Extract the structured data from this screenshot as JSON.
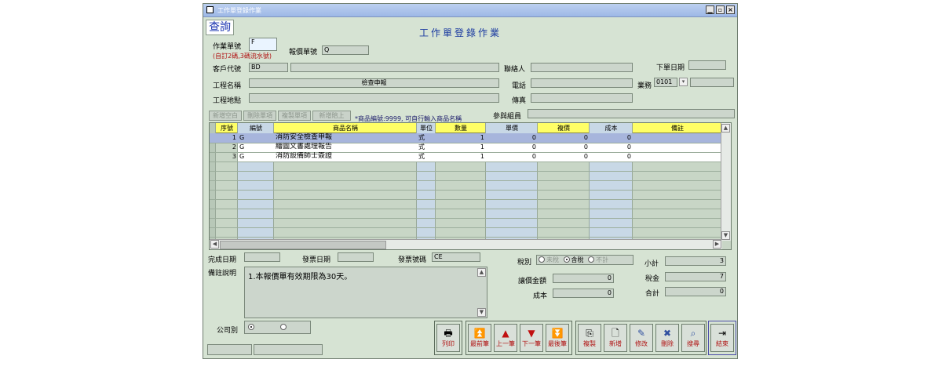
{
  "window": {
    "title": "工作單登錄作業",
    "min": "▁",
    "max": "▫",
    "close": "×"
  },
  "mode_badge": "查詢",
  "form_title": "工作單登錄作業",
  "header": {
    "work_no_label": "作業單號",
    "work_no_value": "F",
    "work_no_hint": "(自訂2碼,3碼流水號)",
    "quote_no_label": "報價單號",
    "quote_no_value": "Q",
    "customer_code_label": "客戶代號",
    "customer_code_value": "BD",
    "contact_label": "聯絡人",
    "order_date_label": "下單日期",
    "project_name_label": "工程名稱",
    "project_name_value": "檢查申報",
    "phone_label": "電話",
    "sales_label": "業務",
    "sales_value": "0101",
    "project_site_label": "工程地點",
    "fax_label": "傳真"
  },
  "item_toolbar": {
    "new_blank": "新增空白",
    "delete_item": "刪除單項",
    "copy_item": "複製單項",
    "insert_above": "新增賠上",
    "note": "*商品編號:9999, 可自行輸入商品名稱",
    "members_label": "參與組員"
  },
  "table": {
    "columns": [
      "序號",
      "編號",
      "商品名稱",
      "單位",
      "數量",
      "單價",
      "複價",
      "成本",
      "備註"
    ],
    "rows": [
      {
        "seq": "1",
        "code": "G",
        "name": "消防安全檢查申報",
        "unit": "式",
        "qty": "1",
        "price": "0",
        "total": "0",
        "cost": "0",
        "remark": ""
      },
      {
        "seq": "2",
        "code": "G",
        "name": "繪圖文書處理報告",
        "unit": "式",
        "qty": "1",
        "price": "0",
        "total": "0",
        "cost": "0",
        "remark": ""
      },
      {
        "seq": "3",
        "code": "G",
        "name": "消防設備師士簽證",
        "unit": "式",
        "qty": "1",
        "price": "0",
        "total": "0",
        "cost": "0",
        "remark": ""
      }
    ]
  },
  "footer": {
    "finish_date_label": "完成日期",
    "invoice_date_label": "發票日期",
    "invoice_no_label": "發票號碼",
    "invoice_no_value": "CE",
    "tax_label": "稅別",
    "tax_options": [
      "未稅",
      "含稅",
      "不計"
    ],
    "tax_selected": "含稅",
    "subtotal_label": "小計",
    "subtotal_value": "3",
    "remark_label": "備註說明",
    "remark_text": "1.本報價單有效期限為30天。",
    "discount_label": "讓價金額",
    "discount_value": "0",
    "tax_amount_label": "稅金",
    "tax_amount_value": "7",
    "cost_label": "成本",
    "cost_value": "0",
    "total_label": "合計",
    "total_value": "0",
    "company_label": "公司別"
  },
  "buttons": {
    "print": "列印",
    "first": "最前筆",
    "prev": "上一筆",
    "next": "下一筆",
    "last": "最後筆",
    "copy": "複製",
    "add": "新增",
    "edit": "修改",
    "delete": "刪除",
    "search": "搜尋",
    "exit": "結束"
  }
}
